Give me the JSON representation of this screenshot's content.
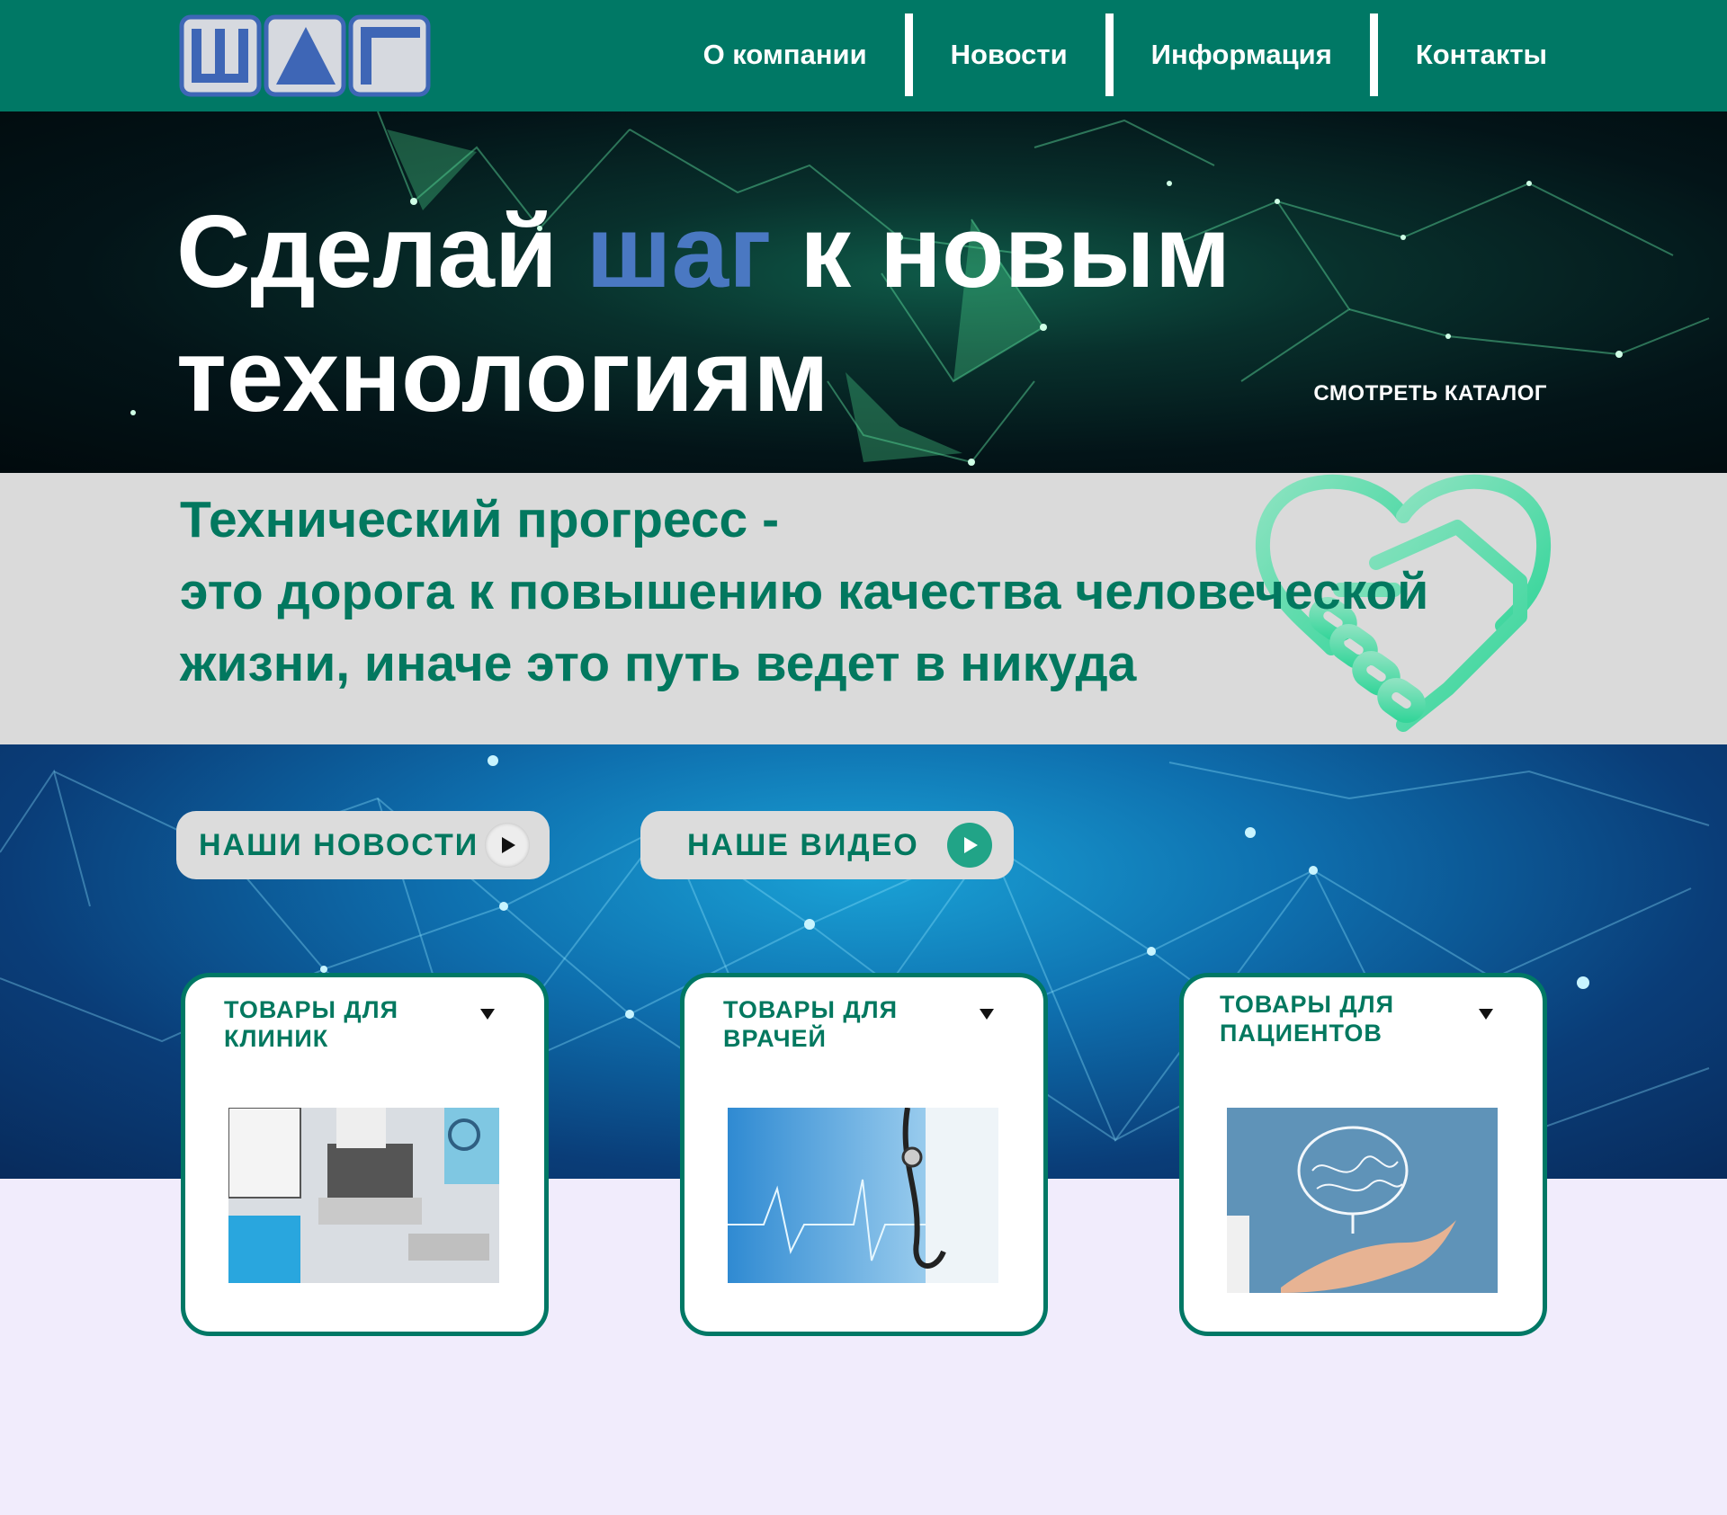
{
  "logo": {
    "letters": [
      "Ш",
      "Δ",
      "Г"
    ]
  },
  "nav": {
    "items": [
      "О компании",
      "Новости",
      "Информация",
      "Контакты"
    ]
  },
  "hero": {
    "title_start": "Сделай ",
    "title_accent": "шаг",
    "title_end": " к новым технологиям",
    "catalog_link": "СМОТРЕТЬ КАТАЛОГ"
  },
  "quote": {
    "line1": "Технический прогресс -",
    "line2": "это дорога к повышению качества человеческой жизни, иначе это путь ведет в никуда"
  },
  "buttons": {
    "news": "НАШИ НОВОСТИ",
    "video": "НАШЕ ВИДЕО"
  },
  "cards": [
    {
      "title": "ТОВАРЫ ДЛЯ КЛИНИК"
    },
    {
      "title": "ТОВАРЫ ДЛЯ ВРАЧЕЙ"
    },
    {
      "title": "ТОВАРЫ ДЛЯ ПАЦИЕНТОВ"
    }
  ],
  "colors": {
    "brand_green": "#007865",
    "accent_blue": "#4a78c2",
    "quote_green": "#02785f",
    "band_gray": "#dadada",
    "page_bg": "#f1ecfc"
  }
}
